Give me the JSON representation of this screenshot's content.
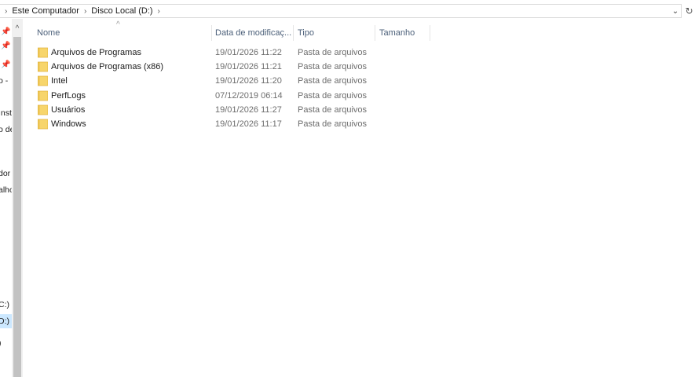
{
  "address": {
    "crumbs": [
      "Este Computador",
      "Disco Local (D:)"
    ]
  },
  "nav": {
    "items": [
      {
        "text": "",
        "pinned": true
      },
      {
        "text": "",
        "pinned": true
      },
      {
        "text": "",
        "pinned": true
      },
      {
        "text": "o -"
      },
      {
        "text": "Inst"
      },
      {
        "text": "o de"
      },
      {
        "text": "dor"
      },
      {
        "text": "alho"
      },
      {
        "text": "C:)"
      },
      {
        "text": "D:)",
        "selected": true
      },
      {
        "text": ")"
      }
    ]
  },
  "columns": {
    "name": "Nome",
    "date": "Data de modificaç...",
    "type": "Tipo",
    "size": "Tamanho"
  },
  "files": [
    {
      "name": "Arquivos de Programas",
      "date": "19/01/2026 11:22",
      "type": "Pasta de arquivos"
    },
    {
      "name": "Arquivos de Programas (x86)",
      "date": "19/01/2026 11:21",
      "type": "Pasta de arquivos"
    },
    {
      "name": "Intel",
      "date": "19/01/2026 11:20",
      "type": "Pasta de arquivos"
    },
    {
      "name": "PerfLogs",
      "date": "07/12/2019 06:14",
      "type": "Pasta de arquivos"
    },
    {
      "name": "Usuários",
      "date": "19/01/2026 11:27",
      "type": "Pasta de arquivos"
    },
    {
      "name": "Windows",
      "date": "19/01/2026 11:17",
      "type": "Pasta de arquivos"
    }
  ],
  "colors": {
    "folder": "#f7d56b",
    "folder_dark": "#e2b33c",
    "selection": "#cce8ff",
    "header_text": "#4c607a"
  }
}
